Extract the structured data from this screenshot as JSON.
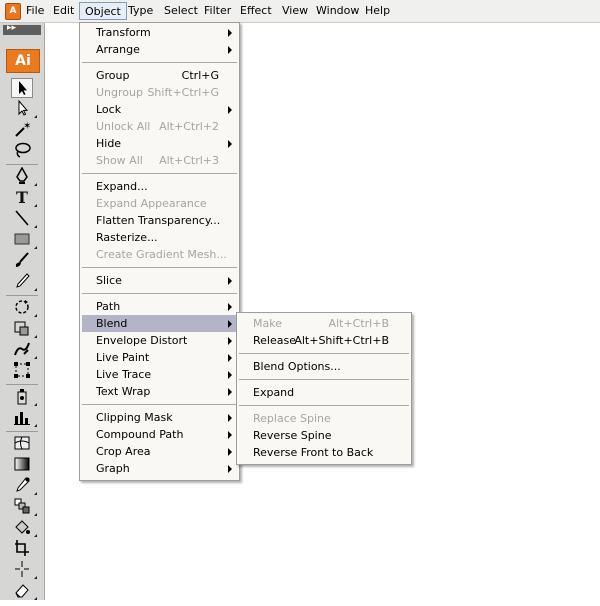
{
  "app": {
    "logo_text": "Ai",
    "toolbox_collapse": "▸▸"
  },
  "menubar": {
    "items": [
      "File",
      "Edit",
      "Object",
      "Type",
      "Select",
      "Filter",
      "Effect",
      "View",
      "Window",
      "Help"
    ]
  },
  "object_menu": {
    "transform": "Transform",
    "arrange": "Arrange",
    "group": "Group",
    "group_sc": "Ctrl+G",
    "ungroup": "Ungroup",
    "ungroup_sc": "Shift+Ctrl+G",
    "lock": "Lock",
    "unlock_all": "Unlock All",
    "unlock_all_sc": "Alt+Ctrl+2",
    "hide": "Hide",
    "show_all": "Show All",
    "show_all_sc": "Alt+Ctrl+3",
    "expand": "Expand...",
    "expand_appearance": "Expand Appearance",
    "flatten_transparency": "Flatten Transparency...",
    "rasterize": "Rasterize...",
    "create_gradient_mesh": "Create Gradient Mesh...",
    "slice": "Slice",
    "path": "Path",
    "blend": "Blend",
    "envelope_distort": "Envelope Distort",
    "live_paint": "Live Paint",
    "live_trace": "Live Trace",
    "text_wrap": "Text Wrap",
    "clipping_mask": "Clipping Mask",
    "compound_path": "Compound Path",
    "crop_area": "Crop Area",
    "graph": "Graph"
  },
  "blend_menu": {
    "make": "Make",
    "make_sc": "Alt+Ctrl+B",
    "release": "Release",
    "release_sc": "Alt+Shift+Ctrl+B",
    "blend_options": "Blend Options...",
    "expand": "Expand",
    "replace_spine": "Replace Spine",
    "reverse_spine": "Reverse Spine",
    "reverse_front_to_back": "Reverse Front to Back"
  },
  "colors": {
    "menu_open": "#316ac5",
    "item_highlight": "#b4b4c8",
    "disabled_text": "#a4a4a0",
    "ai_orange": "#ea7a20"
  },
  "tools": {
    "selection": "selection-arrow-icon",
    "direct_selection": "direct-selection-icon",
    "magic_wand": "magic-wand-icon",
    "lasso": "lasso-icon",
    "pen": "pen-icon",
    "type": "type-icon",
    "line": "line-segment-icon",
    "rectangle": "rectangle-icon",
    "paintbrush": "paintbrush-icon",
    "pencil": "pencil-icon",
    "rotate": "rotate-icon",
    "scale": "scale-icon",
    "warp": "warp-icon",
    "free_transform": "free-transform-icon",
    "symbol_sprayer": "symbol-sprayer-icon",
    "graph": "column-graph-icon",
    "mesh": "mesh-icon",
    "gradient": "gradient-icon",
    "eyedropper": "eyedropper-icon",
    "blend": "blend-tool-icon",
    "live_paint_bucket": "live-paint-bucket-icon",
    "live_paint_selection": "live-paint-selection-icon",
    "crop_area": "crop-area-icon",
    "eraser": "eraser-icon"
  }
}
